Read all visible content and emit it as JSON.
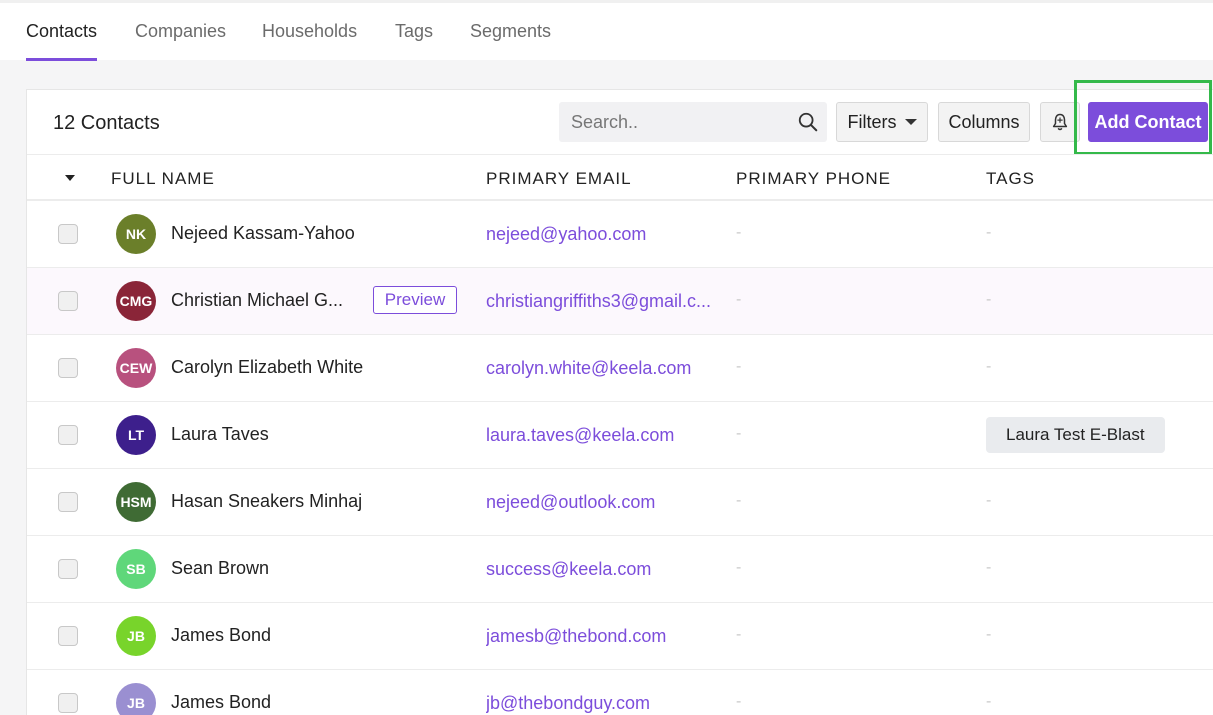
{
  "tabs": [
    {
      "label": "Contacts",
      "active": true
    },
    {
      "label": "Companies",
      "active": false
    },
    {
      "label": "Households",
      "active": false
    },
    {
      "label": "Tags",
      "active": false
    },
    {
      "label": "Segments",
      "active": false
    }
  ],
  "toolbar": {
    "count_label": "12 Contacts",
    "search_placeholder": "Search..",
    "filters_label": "Filters",
    "columns_label": "Columns",
    "add_label": "Add Contact"
  },
  "columns": {
    "full_name": "FULL NAME",
    "primary_email": "PRIMARY EMAIL",
    "primary_phone": "PRIMARY PHONE",
    "tags": "TAGS"
  },
  "preview_label": "Preview",
  "rows": [
    {
      "initials": "NK",
      "avatar_color": "#6b7f2a",
      "name": "Nejeed Kassam-Yahoo",
      "email": "nejeed@yahoo.com",
      "phone": "-",
      "tag": "-"
    },
    {
      "initials": "CMG",
      "avatar_color": "#8a2538",
      "name": "Christian Michael G...",
      "email": "christiangriffiths3@gmail.c...",
      "phone": "-",
      "tag": "-"
    },
    {
      "initials": "CEW",
      "avatar_color": "#b8517e",
      "name": "Carolyn Elizabeth White",
      "email": "carolyn.white@keela.com",
      "phone": "-",
      "tag": "-"
    },
    {
      "initials": "LT",
      "avatar_color": "#3d1f8c",
      "name": "Laura Taves",
      "email": "laura.taves@keela.com",
      "phone": "-",
      "tag": "Laura Test E-Blast"
    },
    {
      "initials": "HSM",
      "avatar_color": "#3f6b34",
      "name": "Hasan Sneakers Minhaj",
      "email": "nejeed@outlook.com",
      "phone": "-",
      "tag": "-"
    },
    {
      "initials": "SB",
      "avatar_color": "#5fd77a",
      "name": "Sean Brown",
      "email": "success@keela.com",
      "phone": "-",
      "tag": "-"
    },
    {
      "initials": "JB",
      "avatar_color": "#78d42b",
      "name": "James Bond",
      "email": "jamesb@thebond.com",
      "phone": "-",
      "tag": "-"
    },
    {
      "initials": "JB",
      "avatar_color": "#9a8fd1",
      "name": "James Bond",
      "email": "jb@thebondguy.com",
      "phone": "-",
      "tag": "-"
    }
  ]
}
